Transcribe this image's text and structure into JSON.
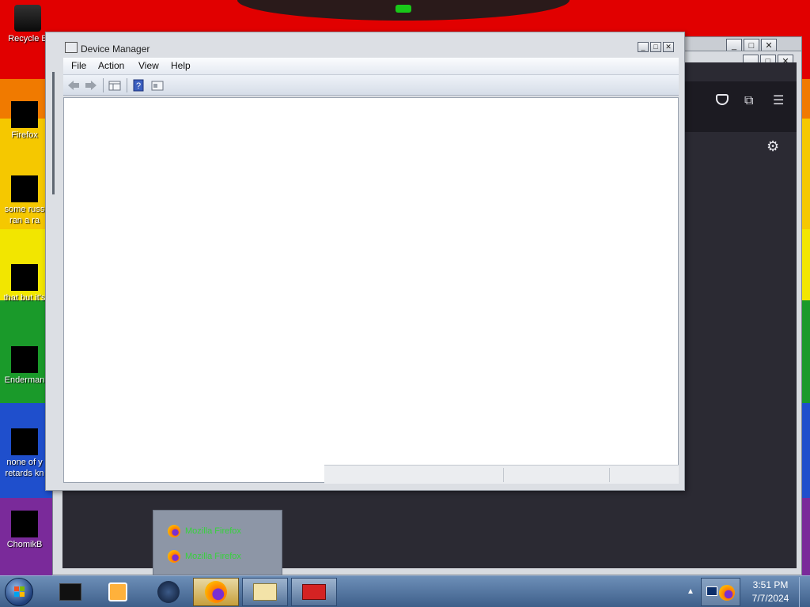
{
  "desktop": {
    "icons": [
      {
        "id": "recycle-bin",
        "label": "Recycle B",
        "label2": ""
      },
      {
        "id": "firefox",
        "label": "Firefox",
        "label2": ""
      },
      {
        "id": "some-russ",
        "label": "some russ",
        "label2": "ran a ra"
      },
      {
        "id": "that-but",
        "label": "that but it's",
        "label2": ""
      },
      {
        "id": "enderman",
        "label": "Enderman",
        "label2": ""
      },
      {
        "id": "none-of-you",
        "label": "none of y",
        "label2": "retards kn"
      },
      {
        "id": "chomik",
        "label": "ChomikB",
        "label2": ""
      }
    ]
  },
  "device_manager": {
    "title": "Device Manager",
    "menu": [
      "File",
      "Action",
      "View",
      "Help"
    ],
    "toolbar": [
      "back-arrow-icon",
      "forward-arrow-icon",
      "console-tree-icon",
      "help-icon",
      "properties-icon"
    ]
  },
  "browser": {
    "toolbar_icons": [
      "pocket-icon",
      "extensions-icon",
      "menu-icon",
      "settings-icon"
    ]
  },
  "taskbar_popup": {
    "items": [
      "Mozilla Firefox",
      "Mozilla Firefox"
    ]
  },
  "taskbar": {
    "buttons": [
      "terminal",
      "media-player",
      "steam",
      "firefox",
      "explorer",
      "toolbox"
    ],
    "clock_time": "3:51 PM",
    "clock_date": "7/7/2024"
  },
  "colors": {
    "popup_text": "#37d23c",
    "taskbar_top": "#6d8fb8",
    "window_frame": "#dcdfe4"
  }
}
